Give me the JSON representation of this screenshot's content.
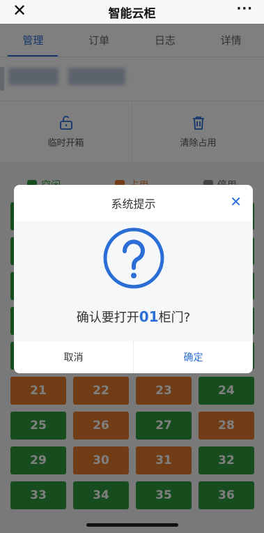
{
  "app": {
    "title": "智能云柜",
    "close_icon": "close-icon",
    "more": "···"
  },
  "tabs": [
    {
      "label": "管理",
      "active": true
    },
    {
      "label": "订单",
      "active": false
    },
    {
      "label": "日志",
      "active": false
    },
    {
      "label": "详情",
      "active": false
    }
  ],
  "actions": [
    {
      "label": "临时开箱",
      "icon": "lock-open-icon"
    },
    {
      "label": "清除占用",
      "icon": "trash-icon"
    }
  ],
  "legend": [
    {
      "label": "空闲",
      "color": "#2f9a3c"
    },
    {
      "label": "占用",
      "color": "#e27a2e"
    },
    {
      "label": "停用",
      "color": "#888888"
    }
  ],
  "lockers": [
    {
      "number": "21",
      "status": "occupied"
    },
    {
      "number": "22",
      "status": "occupied"
    },
    {
      "number": "23",
      "status": "occupied"
    },
    {
      "number": "24",
      "status": "free"
    },
    {
      "number": "25",
      "status": "free"
    },
    {
      "number": "26",
      "status": "occupied"
    },
    {
      "number": "27",
      "status": "free"
    },
    {
      "number": "28",
      "status": "occupied"
    },
    {
      "number": "29",
      "status": "free"
    },
    {
      "number": "30",
      "status": "occupied"
    },
    {
      "number": "31",
      "status": "occupied"
    },
    {
      "number": "32",
      "status": "free"
    },
    {
      "number": "33",
      "status": "free"
    },
    {
      "number": "34",
      "status": "free"
    },
    {
      "number": "35",
      "status": "free"
    },
    {
      "number": "36",
      "status": "free"
    }
  ],
  "dialog": {
    "title": "系统提示",
    "icon": "question-icon",
    "message_prefix": "确认要打开",
    "locker_number": "01",
    "message_suffix": "柜门?",
    "cancel_label": "取消",
    "confirm_label": "确定"
  },
  "colors": {
    "accent": "#2b6fd6",
    "free": "#2f9a3c",
    "occupied": "#e27a2e"
  }
}
